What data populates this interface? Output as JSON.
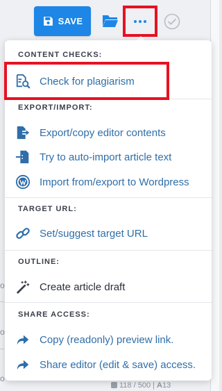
{
  "toolbar": {
    "save_label": "SAVE",
    "folder_icon": "folder-open-icon",
    "more_icon": "ellipsis-icon",
    "check_icon": "check-circle-icon"
  },
  "menu": {
    "sections": [
      {
        "title": "CONTENT CHECKS:",
        "items": [
          {
            "label": "Check for plagiarism",
            "icon": "document-search-icon"
          }
        ]
      },
      {
        "title": "EXPORT/IMPORT:",
        "items": [
          {
            "label": "Export/copy editor contents",
            "icon": "export-arrow-icon"
          },
          {
            "label": "Try to auto-import article text",
            "icon": "import-arrow-icon"
          },
          {
            "label": "Import from/export to Wordpress",
            "icon": "wordpress-icon"
          }
        ]
      },
      {
        "title": "TARGET URL:",
        "items": [
          {
            "label": "Set/suggest target URL",
            "icon": "link-icon"
          }
        ]
      },
      {
        "title": "OUTLINE:",
        "items": [
          {
            "label": "Create article draft",
            "icon": "magic-wand-icon"
          }
        ]
      },
      {
        "title": "SHARE ACCESS:",
        "items": [
          {
            "label": "Copy (readonly) preview link.",
            "icon": "share-arrow-icon"
          },
          {
            "label": "Share editor (edit & save) access.",
            "icon": "share-arrow-icon"
          }
        ]
      }
    ]
  },
  "background": {
    "left_glyphs": [
      "o",
      "o",
      "o"
    ],
    "footer_count": "118 / 500",
    "footer_sep": "|",
    "footer_a": "A",
    "footer_size": "13"
  },
  "colors": {
    "accent": "#1d86e6",
    "link_text": "#2f6ea8",
    "highlight": "#e81123"
  }
}
